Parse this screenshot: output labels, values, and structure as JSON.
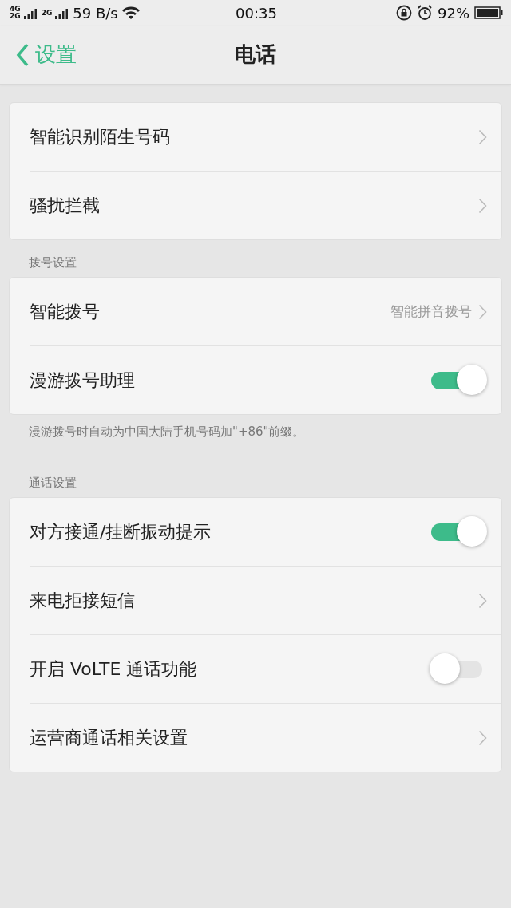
{
  "status_bar": {
    "network_1": "4G",
    "network_2": "2G",
    "network_3": "2G",
    "speed": "59 B/s",
    "time": "00:35",
    "battery": "92%"
  },
  "nav": {
    "back_label": "设置",
    "title": "电话"
  },
  "sections": [
    {
      "items": [
        {
          "kind": "link",
          "label": "智能识别陌生号码"
        },
        {
          "kind": "link",
          "label": "骚扰拦截"
        }
      ]
    },
    {
      "header": "拨号设置",
      "items": [
        {
          "kind": "value",
          "label": "智能拨号",
          "value": "智能拼音拨号"
        },
        {
          "kind": "toggle",
          "label": "漫游拨号助理",
          "on": true
        }
      ],
      "footnote": "漫游拨号时自动为中国大陆手机号码加\"+86\"前缀。"
    },
    {
      "header": "通话设置",
      "items": [
        {
          "kind": "toggle",
          "label": "对方接通/挂断振动提示",
          "on": true
        },
        {
          "kind": "link",
          "label": "来电拒接短信"
        },
        {
          "kind": "toggle",
          "label": "开启 VoLTE 通话功能",
          "on": false
        },
        {
          "kind": "link",
          "label": "运营商通话相关设置"
        }
      ]
    }
  ]
}
